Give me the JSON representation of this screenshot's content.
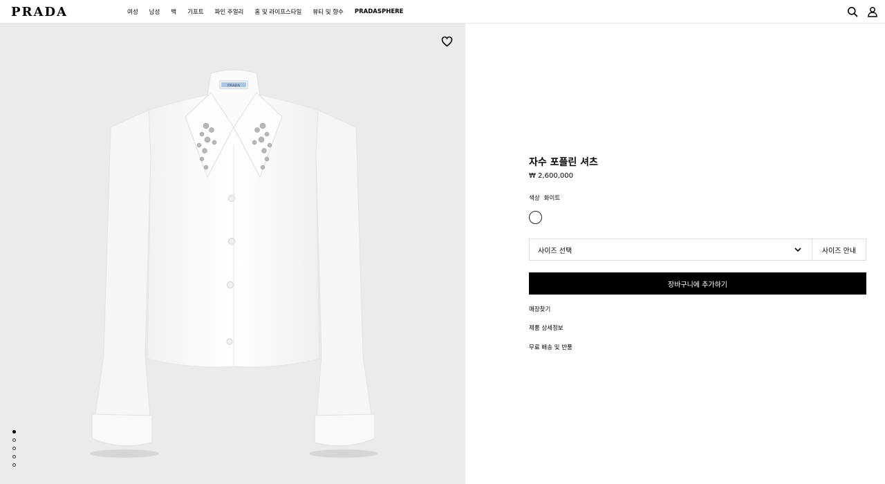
{
  "header": {
    "logo": "PRADA",
    "nav": [
      "여성",
      "남성",
      "백",
      "기프트",
      "파인 주얼리",
      "홈 및 라이프스타일",
      "뷰티 및 향수",
      "PRADASPHERE"
    ]
  },
  "icons": {
    "search": "search-icon",
    "account": "user-icon",
    "wishlist": "heart-icon",
    "dropdown": "chevron-down-icon"
  },
  "gallery": {
    "total_images": 5,
    "active_index": 1,
    "garment_label": "PRADA"
  },
  "product": {
    "name": "자수 포플린 셔츠",
    "price": "₩ 2,600,000",
    "color_label": "색상",
    "color_value": "화이트",
    "size_select_label": "사이즈 선택",
    "size_guide_label": "사이즈 안내",
    "add_to_cart_label": "장바구니에 추가하기",
    "links": [
      "매장찾기",
      "제품 상세정보",
      "무료 배송 및 반품"
    ]
  },
  "colors": {
    "image_background": "#ebebeb",
    "button_background": "#000000",
    "button_text": "#ffffff"
  }
}
